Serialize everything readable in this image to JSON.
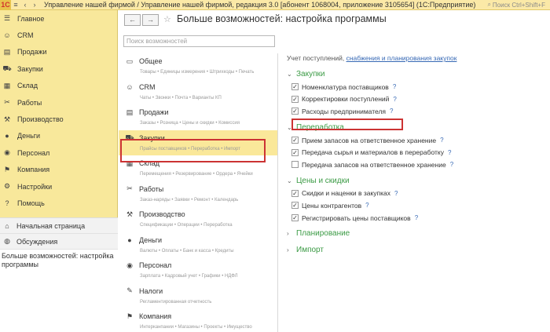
{
  "titlebar": {
    "title": "Управление нашей фирмой / Управление нашей фирмой, редакция 3.0 [абонент 1068004, приложение 3105654] (1С:Предприятие)",
    "search_placeholder": "Поиск Ctrl+Shift+F"
  },
  "sidebar": {
    "items": [
      {
        "label": "Главное",
        "icon": "menu-icon"
      },
      {
        "label": "CRM",
        "icon": "crm-icon"
      },
      {
        "label": "Продажи",
        "icon": "sales-icon"
      },
      {
        "label": "Закупки",
        "icon": "cart-icon"
      },
      {
        "label": "Склад",
        "icon": "warehouse-icon"
      },
      {
        "label": "Работы",
        "icon": "tools-icon"
      },
      {
        "label": "Производство",
        "icon": "factory-icon"
      },
      {
        "label": "Деньги",
        "icon": "money-icon"
      },
      {
        "label": "Персонал",
        "icon": "person-icon"
      },
      {
        "label": "Компания",
        "icon": "flag-icon"
      },
      {
        "label": "Настройки",
        "icon": "gear-icon"
      },
      {
        "label": "Помощь",
        "icon": "help-icon"
      }
    ],
    "lower": [
      {
        "label": "Начальная страница",
        "icon": "home-icon"
      },
      {
        "label": "Обсуждения",
        "icon": "chat-icon"
      }
    ],
    "current_form": "Больше возможностей: настройка программы"
  },
  "header": {
    "back": "←",
    "forward": "→",
    "title": "Больше возможностей: настройка программы"
  },
  "search": {
    "placeholder": "Поиск возможностей"
  },
  "sections": [
    {
      "title": "Общее",
      "sub": "Товары • Единицы измерения • Штрихкоды • Печать",
      "icon": "document-icon"
    },
    {
      "title": "CRM",
      "sub": "Чаты • Звонки • Почта • Варианты КП",
      "icon": "crm-icon"
    },
    {
      "title": "Продажи",
      "sub": "Заказы • Розница • Цены и скидки • Комиссия",
      "icon": "sales-icon"
    },
    {
      "title": "Закупки",
      "sub": "Прайсы поставщиков • Переработка • Импорт",
      "icon": "cart-icon"
    },
    {
      "title": "Склад",
      "sub": "Перемещения • Резервирование • Ордера • Ячейки",
      "icon": "warehouse-icon"
    },
    {
      "title": "Работы",
      "sub": "Заказ-наряды • Заявки • Ремонт • Календарь",
      "icon": "tools-icon"
    },
    {
      "title": "Производство",
      "sub": "Спецификации • Операции • Переработка",
      "icon": "factory-icon"
    },
    {
      "title": "Деньги",
      "sub": "Валюты • Оплаты • Банк и касса • Кредиты",
      "icon": "money-icon"
    },
    {
      "title": "Персонал",
      "sub": "Зарплата • Кадровый учет • Графики • НДФЛ",
      "icon": "person-icon"
    },
    {
      "title": "Налоги",
      "sub": "Регламентированная отчетность",
      "icon": "taxes-icon"
    },
    {
      "title": "Компания",
      "sub": "Интерканпании • Магазины • Проекты • Имущество",
      "icon": "flag-icon"
    }
  ],
  "settings": {
    "info_prefix": "Учет поступлений, ",
    "info_link": "снабжения и планирования закупок",
    "help_mark": "?",
    "groups": [
      {
        "title": "Закупки",
        "expanded_glyph": "⌄",
        "items": [
          {
            "label": "Номенклатура поставщиков",
            "checked": true
          },
          {
            "label": "Корректировки поступлений",
            "checked": true
          },
          {
            "label": "Расходы предпринимателя",
            "checked": true
          }
        ]
      },
      {
        "title": "Переработка",
        "expanded_glyph": "⌄",
        "items": [
          {
            "label": "Прием запасов на ответственное хранение",
            "checked": true
          },
          {
            "label": "Передача сырья и материалов в переработку",
            "checked": true
          },
          {
            "label": "Передача запасов на ответственное хранение",
            "checked": false
          }
        ]
      },
      {
        "title": "Цены и скидки",
        "expanded_glyph": "⌄",
        "items": [
          {
            "label": "Скидки и наценки в закупках",
            "checked": true
          },
          {
            "label": "Цены контрагентов",
            "checked": true
          },
          {
            "label": "Регистрировать цены поставщиков",
            "checked": true
          }
        ]
      },
      {
        "title": "Планирование",
        "expanded_glyph": "›",
        "items": []
      },
      {
        "title": "Импорт",
        "expanded_glyph": "›",
        "items": []
      }
    ]
  },
  "colors": {
    "accent_green": "#3c9b46",
    "sidebar_yellow": "#f8e89b",
    "highlight_red": "#cc3333",
    "link_blue": "#3769b5"
  }
}
